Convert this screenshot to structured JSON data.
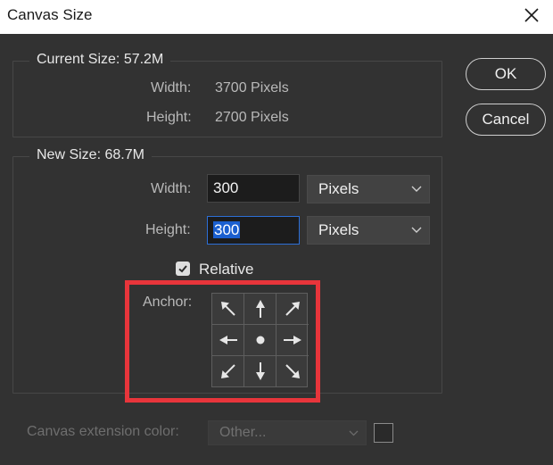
{
  "window": {
    "title": "Canvas Size"
  },
  "buttons": {
    "ok": "OK",
    "cancel": "Cancel"
  },
  "current_size": {
    "legend": "Current Size: 57.2M",
    "width_label": "Width:",
    "width_value": "3700 Pixels",
    "height_label": "Height:",
    "height_value": "2700 Pixels"
  },
  "new_size": {
    "legend": "New Size: 68.7M",
    "width_label": "Width:",
    "width_value": "300",
    "width_unit": "Pixels",
    "height_label": "Height:",
    "height_value": "300",
    "height_unit": "Pixels",
    "relative_label": "Relative",
    "relative_checked": true,
    "anchor_label": "Anchor:",
    "anchor_selected": "center"
  },
  "extension": {
    "label": "Canvas extension color:",
    "value": "Other..."
  },
  "colors": {
    "highlight": "#e8353b",
    "selection": "#1a5fcf",
    "focus_border": "#2c6fd6"
  }
}
